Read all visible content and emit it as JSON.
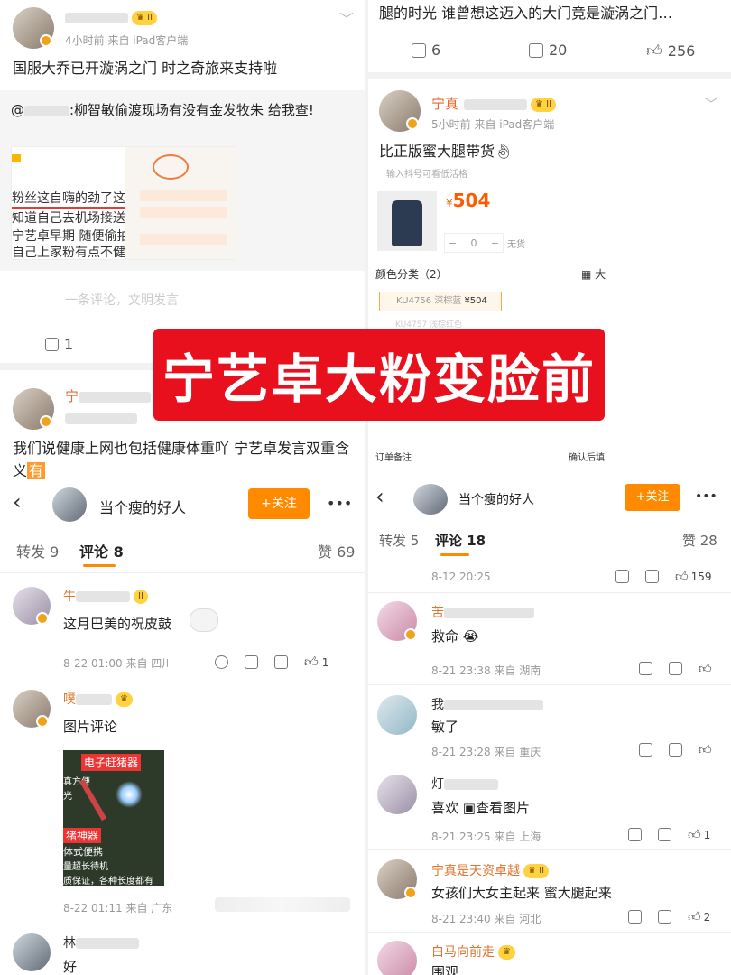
{
  "overlay_title": "宁艺卓大粉变脸前",
  "left_post": {
    "time_source": "4小时前  来自 iPad客户端",
    "text": "国服大乔已开漩涡之门 时之奇旅来支持啦",
    "quote_text": ":柳智敏偷渡现场有没有金发牧朱 给我查!",
    "quote_prefix": "@",
    "quote_image_lines": [
      "粉丝这自嗨的劲了这",
      "知道自己去机场接送",
      "宁艺卓早期 随便偷拍",
      "自己上家粉有点不健"
    ],
    "comment_placeholder": "一条评论，文明发言",
    "repost_count": "1"
  },
  "left_post2": {
    "name_partial": "宁",
    "text": "我们说健康上网也包括健康体重吖 宁艺卓发言双重含义",
    "highlight": "有"
  },
  "right_post": {
    "top_text": "腿的时光 谁曾想这迈入的大门竟是漩涡之门…",
    "repost": "6",
    "comments": "20",
    "likes": "256",
    "name": "宁真",
    "time_source": "5小时前  来自 iPad客户端",
    "text": "比正版蜜大腿带货",
    "shop_hint": "输入抖号可看低活格",
    "price": "504",
    "currency": "¥",
    "qty": "0",
    "no_stock": "无货",
    "color_label": "颜色分类（2）",
    "big_label": "大",
    "option1": "KU4756 深棕蓝",
    "option1_price": "¥504",
    "option2": "KU4757 浅棕红色",
    "note": "订单备注",
    "confirm": "确认后填"
  },
  "left_detail": {
    "title": "当个瘦的好人",
    "follow": "+关注",
    "more": "•••",
    "tabs": [
      "转发 9",
      "评论 8",
      "赞 69"
    ],
    "comments": [
      {
        "name": "牛",
        "text": "这月巴美的祝皮鼓",
        "meta": "8-22 01:00  来自 四川",
        "likes": "1"
      },
      {
        "name": "噗",
        "text": "图片评论",
        "meta": "8-22 01:11  来自 广东",
        "likes": ""
      },
      {
        "name": "林",
        "text": "好",
        "meta": "",
        "likes": ""
      }
    ],
    "ad_lines": [
      "电子赶猪器",
      "真方便",
      "光",
      "猪神器",
      "体式便携",
      "量超长待机",
      "质保证，各种长度都有"
    ]
  },
  "right_detail": {
    "title": "当个瘦的好人",
    "follow": "+关注",
    "more": "•••",
    "tabs": [
      "转发 5",
      "评论 18",
      "赞 28"
    ],
    "first_meta": "8-12 20:25",
    "first_likes": "159",
    "comments": [
      {
        "name": "苦",
        "text": "救命",
        "meta": "8-21 23:38  来自 湖南",
        "likes": ""
      },
      {
        "name": "我",
        "text": "敏了",
        "meta": "8-21 23:28  来自 重庆",
        "likes": ""
      },
      {
        "name": "灯",
        "text": "喜欢",
        "extra": "查看图片",
        "meta": "8-21 23:25  来自 上海",
        "likes": "1"
      },
      {
        "name": "宁真是天资卓越",
        "text": "女孩们大女主起来 蜜大腿起来",
        "meta": "8-21 23:40  来自 河北",
        "likes": "2"
      },
      {
        "name": "白马向前走",
        "text": "围观",
        "meta": "",
        "likes": ""
      }
    ]
  },
  "colors": {
    "accent": "#ff8a00",
    "overlay": "#e8101d",
    "name": "#e8672d"
  }
}
